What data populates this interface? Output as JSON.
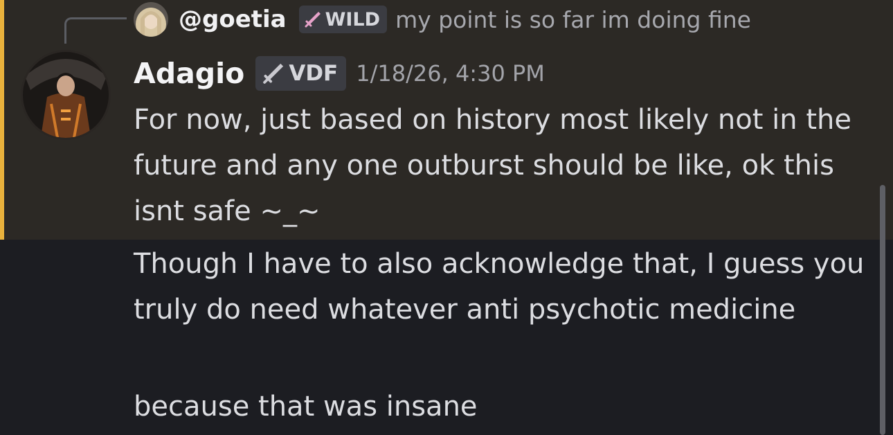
{
  "reply": {
    "username": "@goetia",
    "badge": "WILD",
    "badge_icon": "sword-icon",
    "badge_icon_color": "#e6a2c9",
    "preview": "my point is so far im doing fine"
  },
  "message": {
    "author": "Adagio",
    "badge": "VDF",
    "badge_icon": "sword-icon",
    "badge_icon_color": "#c9c9cf",
    "timestamp": "1/18/26, 4:30 PM",
    "lines": [
      "For now, just based on history most likely not in the future and any one outburst should be like, ok this isnt safe ~_~",
      "Though I have to also acknowledge that, I guess you truly do need whatever anti psychotic medicine",
      "because that was insane"
    ]
  },
  "colors": {
    "background": "#1c1d22",
    "highlight": "#2c2925",
    "highlight_bar": "#e8b13c"
  }
}
